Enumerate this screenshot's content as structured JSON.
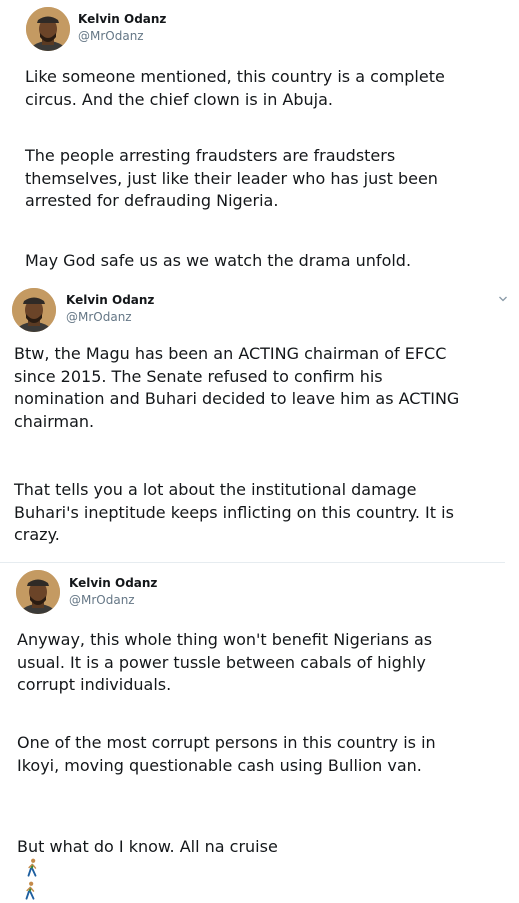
{
  "tweets": [
    {
      "author": {
        "name": "Kelvin Odanz",
        "handle": "@MrOdanz"
      },
      "paragraphs": [
        "Like someone mentioned, this country is a complete\ncircus. And the chief clown is in Abuja.",
        "The people arresting fraudsters are fraudsters\nthemselves, just like their leader who has just been\narrested for defrauding Nigeria.",
        "May God safe us as we watch the drama unfold."
      ]
    },
    {
      "author": {
        "name": "Kelvin Odanz",
        "handle": "@MrOdanz"
      },
      "menu_icon": "chevron-down-icon",
      "paragraphs": [
        "Btw, the Magu has been an ACTING chairman of EFCC\nsince 2015. The Senate refused to confirm his\nnomination and Buhari decided to leave him as ACTING\nchairman.",
        "That tells you a lot about the institutional damage\nBuhari's ineptitude keeps inflicting on this country. It is\ncrazy."
      ]
    },
    {
      "author": {
        "name": "Kelvin Odanz",
        "handle": "@MrOdanz"
      },
      "paragraphs": [
        "Anyway, this whole thing won't benefit Nigerians as\nusual. It is a power tussle between cabals of highly\ncorrupt individuals.",
        "One of the most corrupt persons in this country is in\nIkoyi, moving questionable cash using Bullion van.",
        "But what do I know. All na cruise"
      ],
      "trailing_emoji": [
        "person-walking-icon",
        "person-walking-icon"
      ]
    }
  ],
  "colors": {
    "text": "#14171a",
    "handle": "#657786",
    "divider": "#e6ecf0",
    "avatar_bg": "#b98c52",
    "walker": "#3a8a3a"
  }
}
